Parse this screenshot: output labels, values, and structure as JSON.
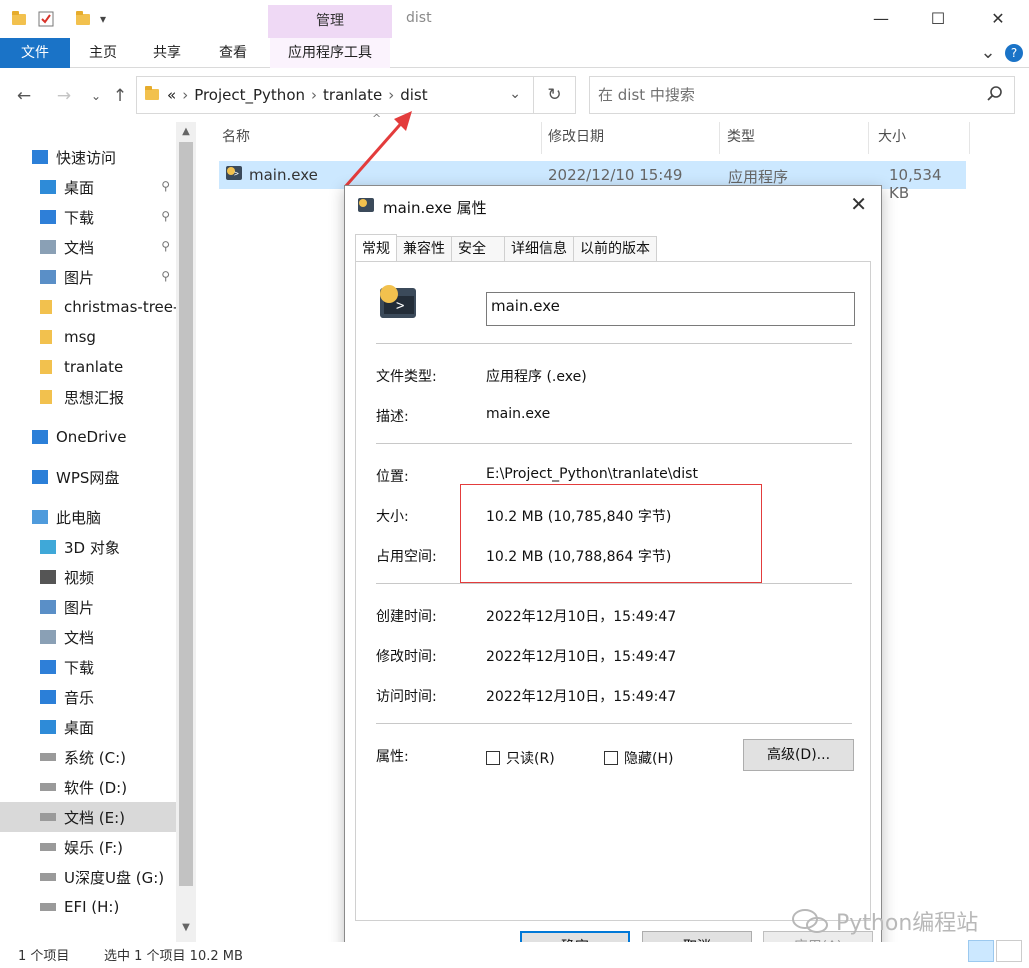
{
  "window": {
    "title": "dist",
    "manage_tab": "管理",
    "qa_dropdown": "▾",
    "min": "—",
    "max": "☐",
    "close": "✕"
  },
  "ribbon": {
    "tabs": [
      "文件",
      "主页",
      "共享",
      "查看",
      "应用程序工具"
    ],
    "expand": "⌄",
    "help": "?"
  },
  "address": {
    "prefix": "«",
    "crumbs": [
      "Project_Python",
      "tranlate",
      "dist"
    ],
    "sep": "›"
  },
  "search": {
    "placeholder": "在 dist 中搜索"
  },
  "sidebar": {
    "items": [
      {
        "label": "快速访问",
        "icon": "star-icon"
      },
      {
        "label": "桌面",
        "icon": "desktop-icon",
        "pinned": true
      },
      {
        "label": "下载",
        "icon": "download-icon",
        "pinned": true
      },
      {
        "label": "文档",
        "icon": "document-icon",
        "pinned": true
      },
      {
        "label": "图片",
        "icon": "picture-icon",
        "pinned": true
      },
      {
        "label": "christmas-tree-",
        "icon": "folder-icon"
      },
      {
        "label": "msg",
        "icon": "folder-icon"
      },
      {
        "label": "tranlate",
        "icon": "folder-icon"
      },
      {
        "label": "思想汇报",
        "icon": "folder-icon"
      },
      {
        "label": "OneDrive",
        "icon": "cloud-icon"
      },
      {
        "label": "WPS网盘",
        "icon": "cloud-icon"
      },
      {
        "label": "此电脑",
        "icon": "computer-icon"
      },
      {
        "label": "3D 对象",
        "icon": "cube-icon"
      },
      {
        "label": "视频",
        "icon": "video-icon"
      },
      {
        "label": "图片",
        "icon": "picture-icon"
      },
      {
        "label": "文档",
        "icon": "document-icon"
      },
      {
        "label": "下载",
        "icon": "download-icon"
      },
      {
        "label": "音乐",
        "icon": "music-icon"
      },
      {
        "label": "桌面",
        "icon": "desktop-icon"
      },
      {
        "label": "系统 (C:)",
        "icon": "drive-icon"
      },
      {
        "label": "软件 (D:)",
        "icon": "drive-icon"
      },
      {
        "label": "文档 (E:)",
        "icon": "drive-icon",
        "selected": true
      },
      {
        "label": "娱乐 (F:)",
        "icon": "drive-icon"
      },
      {
        "label": "U深度U盘 (G:)",
        "icon": "drive-icon"
      },
      {
        "label": "EFI (H:)",
        "icon": "drive-icon"
      }
    ],
    "pin_glyph": "📌"
  },
  "filelist": {
    "columns": [
      "名称",
      "修改日期",
      "类型",
      "大小"
    ],
    "rows": [
      {
        "name": "main.exe",
        "modified": "2022/12/10 15:49",
        "type": "应用程序",
        "size": "10,534 KB"
      }
    ]
  },
  "dialog": {
    "title": "main.exe 属性",
    "tabs": [
      "常规",
      "兼容性",
      "安全",
      "详细信息",
      "以前的版本"
    ],
    "filename": "main.exe",
    "fields": {
      "type_label": "文件类型:",
      "type_value": "应用程序 (.exe)",
      "desc_label": "描述:",
      "desc_value": "main.exe",
      "loc_label": "位置:",
      "loc_value": "E:\\Project_Python\\tranlate\\dist",
      "size_label": "大小:",
      "size_value": "10.2 MB (10,785,840 字节)",
      "disk_label": "占用空间:",
      "disk_value": "10.2 MB (10,788,864 字节)",
      "created_label": "创建时间:",
      "created_value": "2022年12月10日，15:49:47",
      "modified_label": "修改时间:",
      "modified_value": "2022年12月10日，15:49:47",
      "accessed_label": "访问时间:",
      "accessed_value": "2022年12月10日，15:49:47",
      "attr_label": "属性:"
    },
    "readonly_label": "只读(R)",
    "hidden_label": "隐藏(H)",
    "advanced_label": "高级(D)...",
    "ok_label": "确定",
    "cancel_label": "取消",
    "apply_label": "应用(A)"
  },
  "status": {
    "items": "1 个项目",
    "selected": "选中 1 个项目  10.2 MB"
  },
  "watermark": "Python编程站",
  "colors": {
    "accent": "#1a73c7",
    "selection": "#cce8ff",
    "highlight_box": "#e33c3c",
    "manage_tab": "#efd9f5"
  }
}
